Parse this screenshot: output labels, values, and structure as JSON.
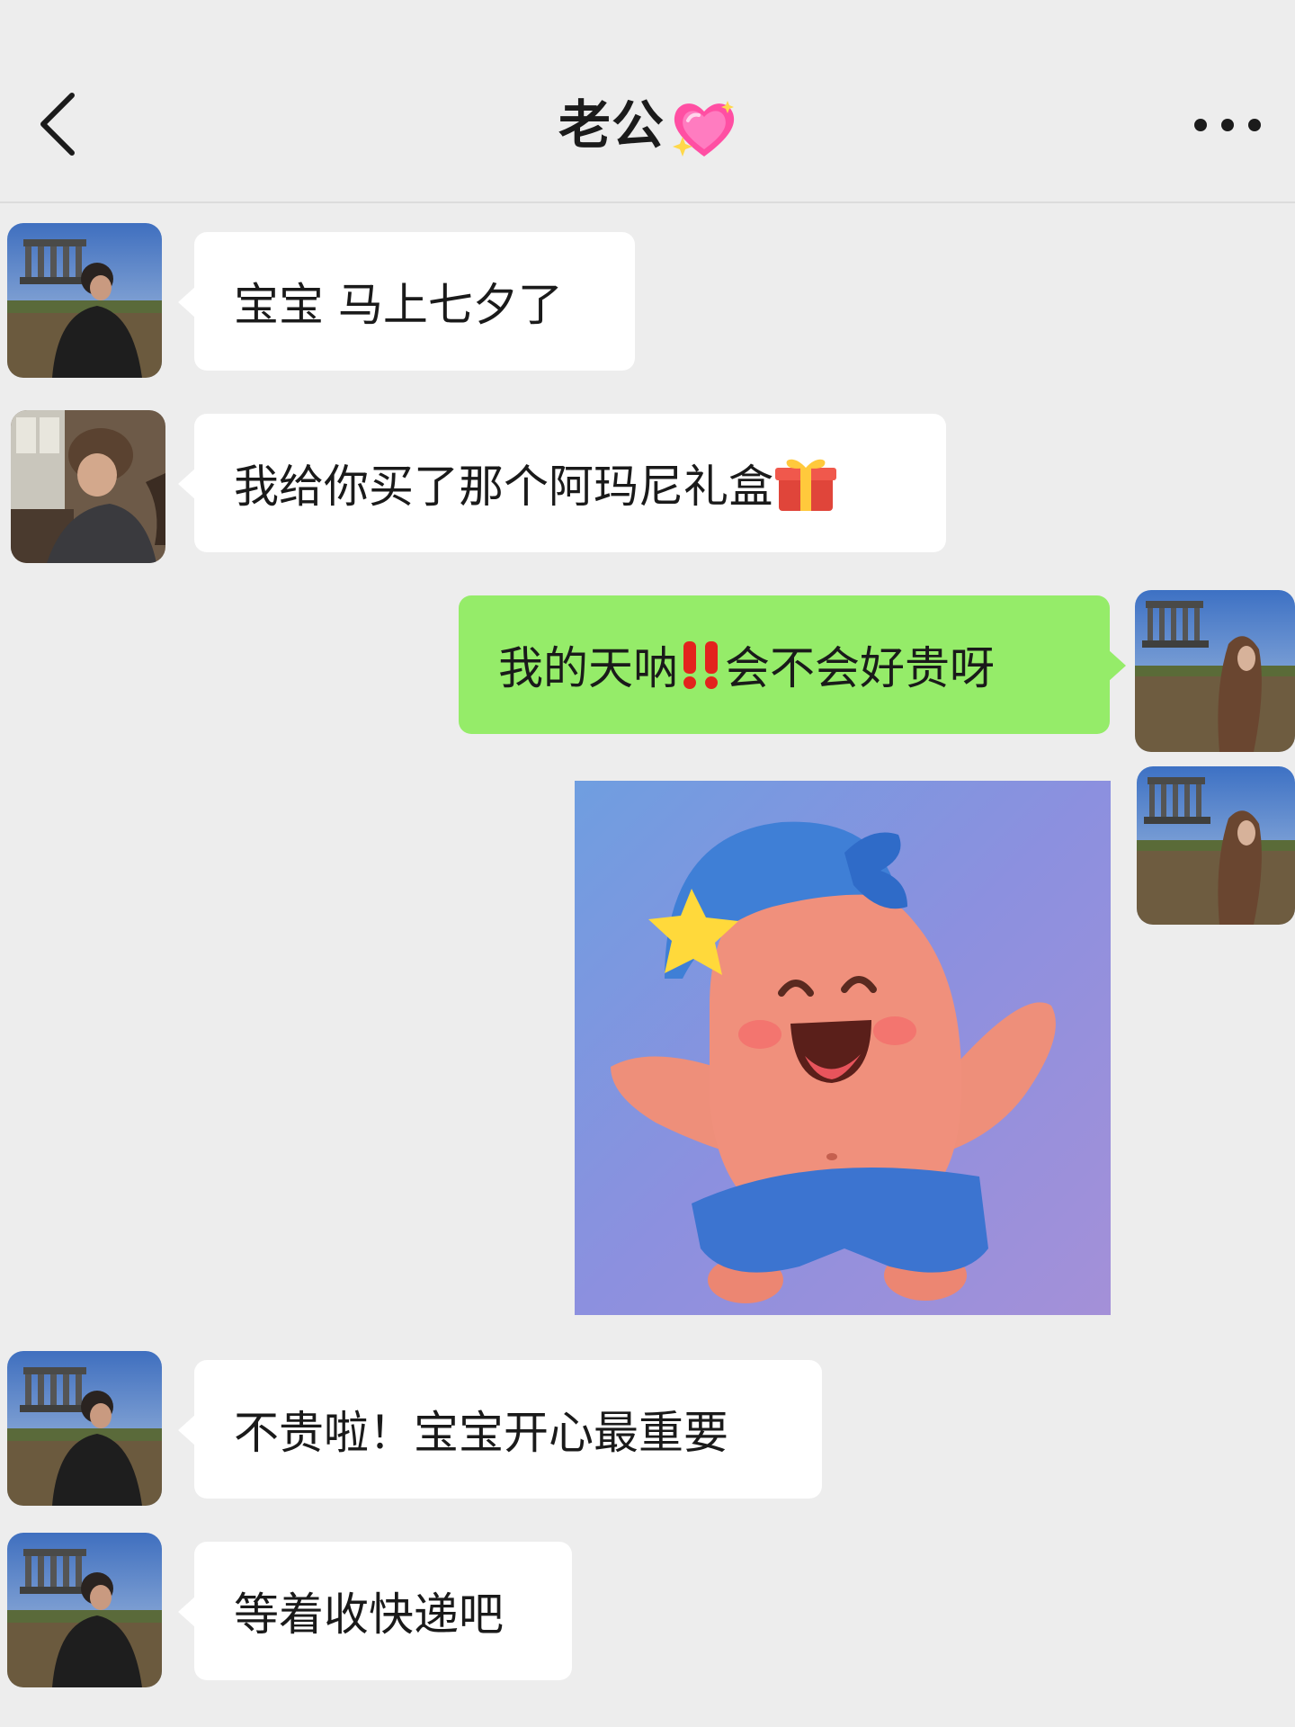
{
  "header": {
    "title": "老公",
    "title_emoji": "sparkling-heart-icon"
  },
  "messages": [
    {
      "side": "left",
      "avatar": "boyfriend-avatar-monument",
      "text": "宝宝 马上七夕了"
    },
    {
      "side": "left",
      "avatar": "boyfriend-avatar-indoor",
      "text": "我给你买了那个阿玛尼礼盒",
      "emoji": "gift-icon"
    },
    {
      "side": "right",
      "avatar": "girlfriend-avatar",
      "text_before": "我的天呐",
      "emoji": "double-exclamation-icon",
      "text_after": "会不会好贵呀"
    },
    {
      "side": "right",
      "avatar": "girlfriend-avatar",
      "sticker": "patrick-star-sticker"
    },
    {
      "side": "left",
      "avatar": "boyfriend-avatar-monument",
      "text": "不贵啦！宝宝开心最重要"
    },
    {
      "side": "left",
      "avatar": "boyfriend-avatar-monument",
      "text": "等着收快递吧"
    }
  ],
  "colors": {
    "background": "#ededed",
    "left_bubble": "#ffffff",
    "right_bubble": "#95ec69"
  }
}
